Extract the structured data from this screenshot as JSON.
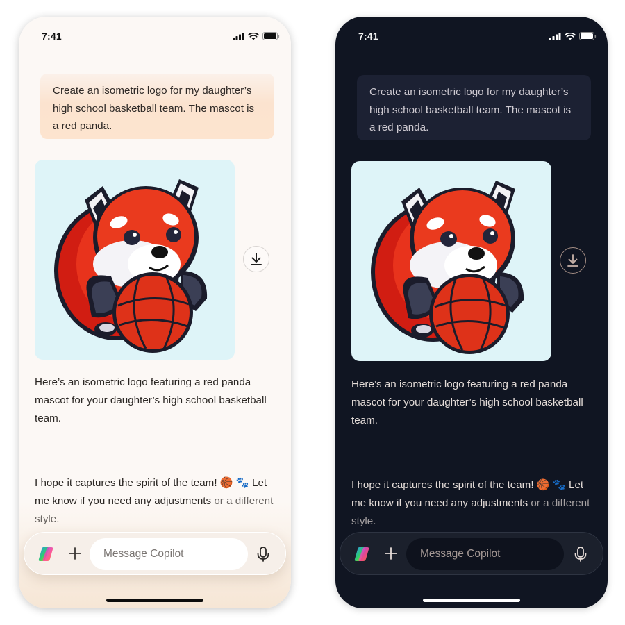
{
  "status_bar": {
    "time": "7:41",
    "icons": [
      "cellular-signal-icon",
      "wifi-icon",
      "battery-icon"
    ]
  },
  "conversation": {
    "user_message": "Create an isometric logo for my daughter’s high school basketball team. The mascot is a red panda.",
    "generated_image": {
      "alt": "Red panda mascot hugging a basketball logo",
      "action": "download-icon"
    },
    "reply_paragraph_1": "Here’s an isometric logo featuring a red panda mascot for your daughter’s high school basketball team.",
    "reply_paragraph_2_main": "I hope it captures the spirit of the team! 🏀 🐾 Let me know if you need any adjustments",
    "reply_paragraph_2_tail": "or a different style."
  },
  "composer": {
    "logo": "copilot-logo-icon",
    "add_icon": "plus-icon",
    "placeholder": "Message Copilot",
    "value": "",
    "voice_icon": "microphone-icon"
  },
  "themes": {
    "light": {
      "background": "#fcf8f5",
      "bubble": "#fde4cf",
      "image_bg": "#def4f8"
    },
    "dark": {
      "background": "#101522",
      "bubble": "#1c2133",
      "image_bg": "#def4f8"
    }
  }
}
